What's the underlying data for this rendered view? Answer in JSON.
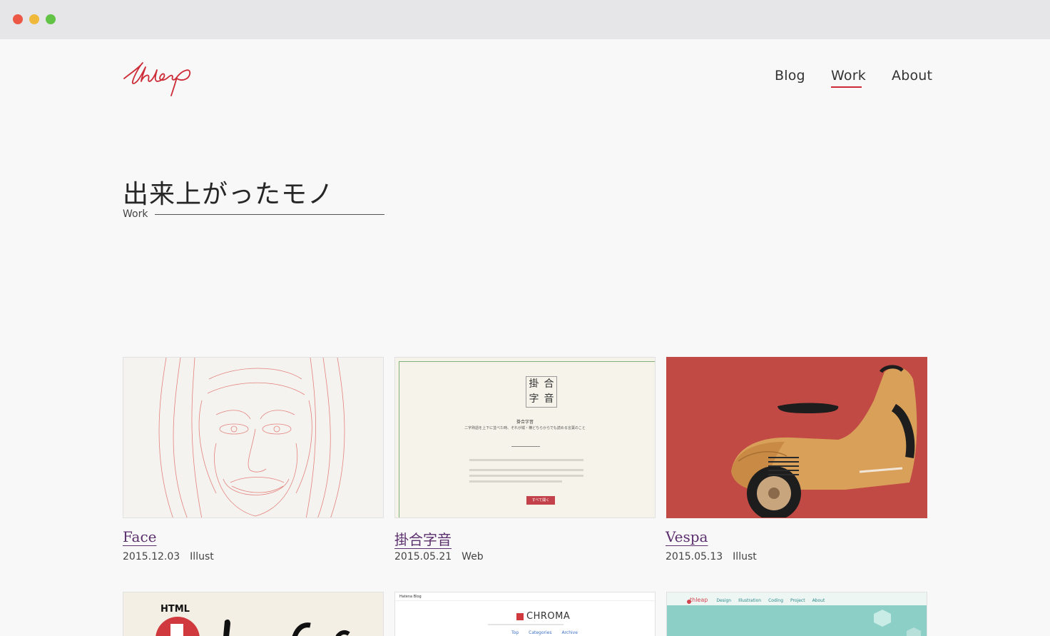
{
  "window": {
    "controls": [
      "close",
      "minimize",
      "maximize"
    ]
  },
  "header": {
    "logo_text": "thleap",
    "nav": [
      {
        "label": "Blog",
        "active": false
      },
      {
        "label": "Work",
        "active": true
      },
      {
        "label": "About",
        "active": false
      }
    ]
  },
  "page": {
    "title": "出来上がったモノ",
    "subtitle": "Work"
  },
  "works": [
    {
      "title": "Face",
      "date": "2015.12.03",
      "category": "Illust"
    },
    {
      "title": "掛合字音",
      "date": "2015.05.21",
      "category": "Web",
      "thumb": {
        "grid": [
          "掛",
          "合",
          "字",
          "音"
        ],
        "name": "掛合字音",
        "desc": "二字熟語を上下に並べた時、それが縦・横どちらからでも読める言葉のこと",
        "button": "すべて開く"
      }
    },
    {
      "title": "Vespa",
      "date": "2015.05.13",
      "category": "Illust"
    }
  ],
  "works_row2": [
    {
      "thumb_heading": "HTML"
    },
    {
      "thumb": {
        "site": "Hatena Blog",
        "logo": "CHROMA",
        "nav": [
          "Top",
          "Categories",
          "Archive"
        ]
      }
    },
    {
      "thumb": {
        "brand": "thleap",
        "nav": [
          "Design",
          "Illustration",
          "Coding",
          "Project",
          "About"
        ]
      }
    }
  ],
  "colors": {
    "accent": "#cd2b37",
    "link": "#5c2f6e",
    "background": "#f7f8f7"
  }
}
